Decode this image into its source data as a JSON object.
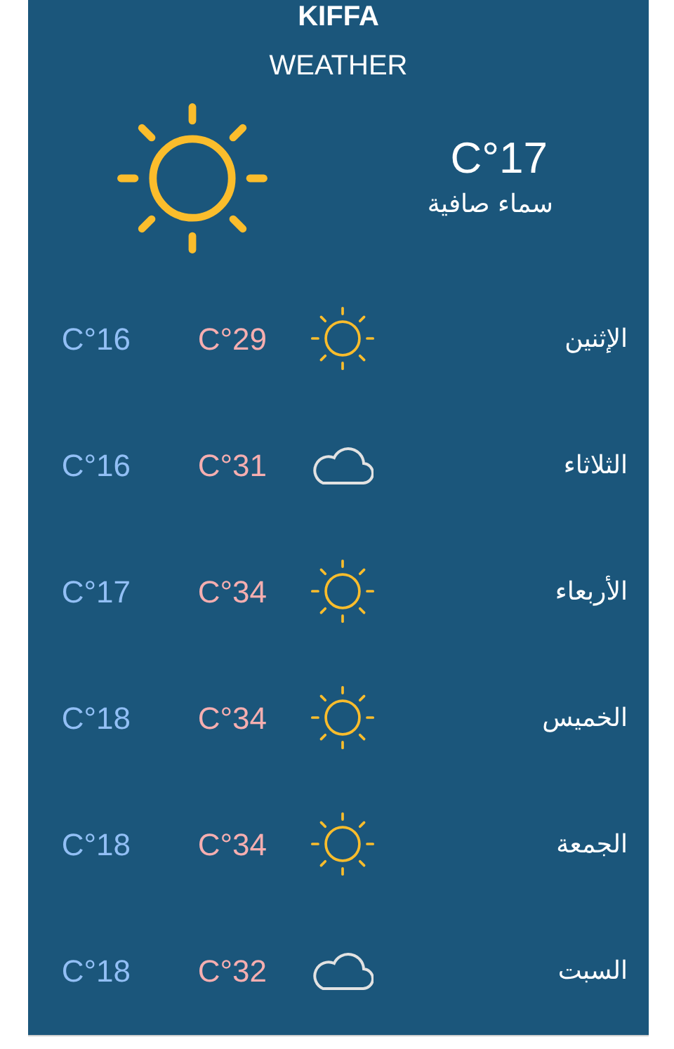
{
  "header": {
    "city": "KIFFA",
    "subtitle": "WEATHER"
  },
  "current": {
    "kind": "sun",
    "temperature": "C°17",
    "description": "سماء صافية"
  },
  "forecast": [
    {
      "day": "الإثنين",
      "kind": "sun",
      "high": "C°29",
      "low": "C°16"
    },
    {
      "day": "الثلاثاء",
      "kind": "cloud",
      "high": "C°31",
      "low": "C°16"
    },
    {
      "day": "الأربعاء",
      "kind": "sun",
      "high": "C°34",
      "low": "C°17"
    },
    {
      "day": "الخميس",
      "kind": "sun",
      "high": "C°34",
      "low": "C°18"
    },
    {
      "day": "الجمعة",
      "kind": "sun",
      "high": "C°34",
      "low": "C°18"
    },
    {
      "day": "السبت",
      "kind": "cloud",
      "high": "C°32",
      "low": "C°18"
    }
  ]
}
